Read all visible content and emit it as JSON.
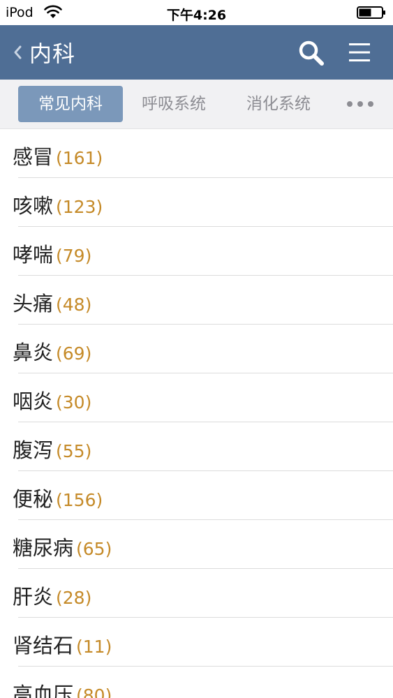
{
  "status_bar": {
    "device": "iPod",
    "time": "下午4:26"
  },
  "nav": {
    "title": "内科"
  },
  "tabs": [
    {
      "label": "常见内科",
      "active": true
    },
    {
      "label": "呼吸系统",
      "active": false
    },
    {
      "label": "消化系统",
      "active": false
    }
  ],
  "list": [
    {
      "name": "感冒",
      "count": "(161)"
    },
    {
      "name": "咳嗽",
      "count": "(123)"
    },
    {
      "name": "哮喘",
      "count": "(79)"
    },
    {
      "name": "头痛",
      "count": "(48)"
    },
    {
      "name": "鼻炎",
      "count": "(69)"
    },
    {
      "name": "咽炎",
      "count": "(30)"
    },
    {
      "name": "腹泻",
      "count": "(55)"
    },
    {
      "name": "便秘",
      "count": "(156)"
    },
    {
      "name": "糖尿病",
      "count": "(65)"
    },
    {
      "name": "肝炎",
      "count": "(28)"
    },
    {
      "name": "肾结石",
      "count": "(11)"
    },
    {
      "name": "高血压",
      "count": "(80)"
    }
  ],
  "colors": {
    "nav_bg": "#4f6e95",
    "tab_active_bg": "#7b98ba",
    "count_text": "#c58a28"
  },
  "icons": {
    "back": "chevron-left-icon",
    "search": "search-icon",
    "menu": "hamburger-menu-icon",
    "more": "more-dots-icon",
    "wifi": "wifi-icon",
    "battery": "battery-icon"
  }
}
